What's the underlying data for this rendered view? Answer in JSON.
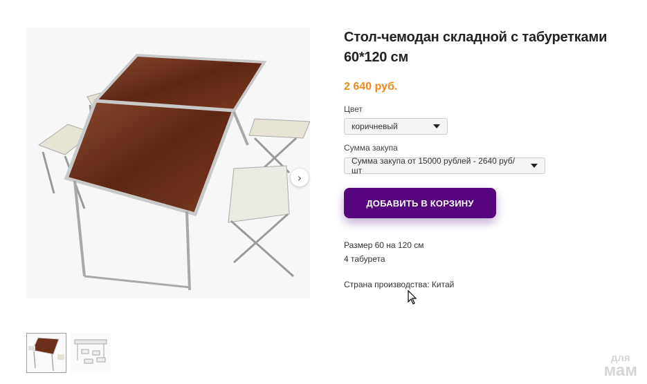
{
  "product": {
    "title": "Стол-чемодан складной с табуретками 60*120 см",
    "price": "2 640 руб."
  },
  "options": {
    "color": {
      "label": "Цвет",
      "selected": "коричневый"
    },
    "quantity": {
      "label": "Сумма закупа",
      "selected": "Сумма закупа от 15000 рублей - 2640 руб/шт"
    }
  },
  "actions": {
    "add_to_cart": "ДОБАВИТЬ В КОРЗИНУ"
  },
  "description": {
    "line1": "Размер 60 на 120 см",
    "line2": "4 табурета",
    "line3": "Страна производства: Китай"
  },
  "gallery": {
    "next_icon": "chevron-right-icon"
  },
  "watermark": {
    "line1": "для",
    "line2": "мам"
  },
  "colors": {
    "accent": "#56057f",
    "price": "#ef8a1c",
    "wood": "#6b2f1a"
  }
}
